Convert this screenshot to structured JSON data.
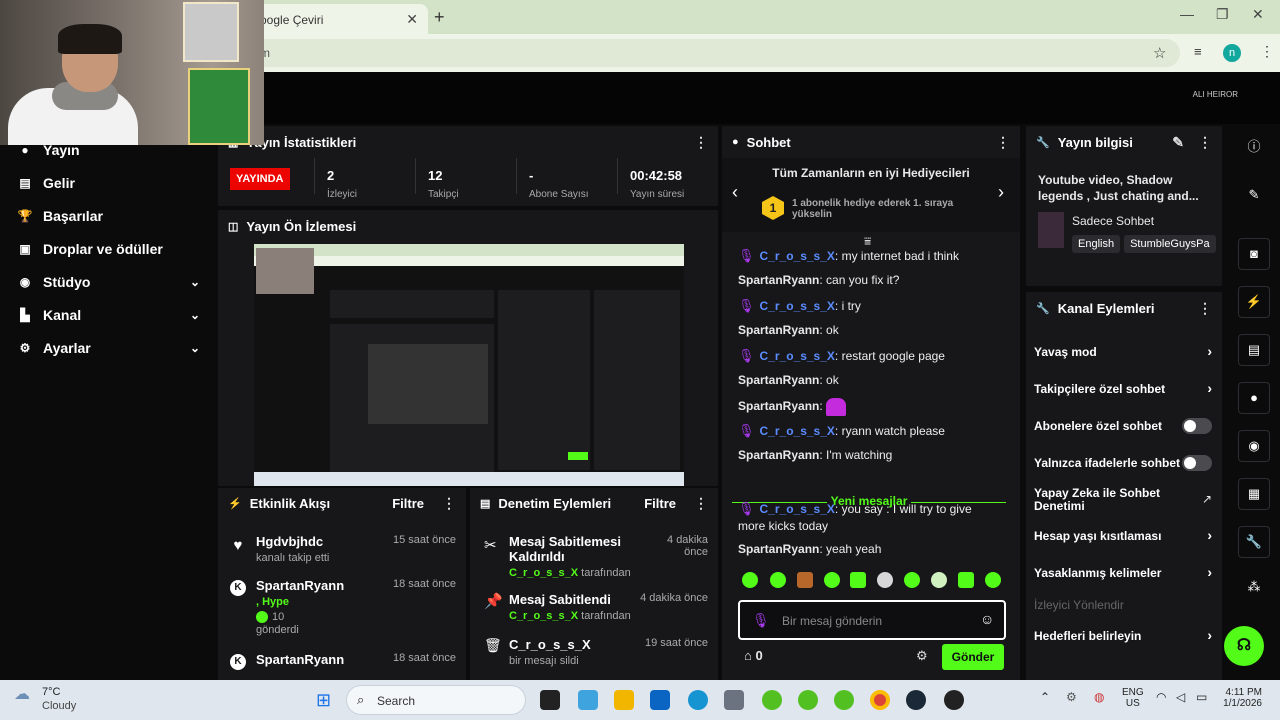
{
  "browser": {
    "tab_title": "oogle Çeviri",
    "tab_close": "✕",
    "new_tab": "+",
    "addr_text": "m",
    "profile_initial": "n"
  },
  "app": {
    "brand_text": "ALI HEIROR"
  },
  "sidebar": {
    "items": [
      {
        "label": "Yayın",
        "icon": "●"
      },
      {
        "label": "Gelir",
        "icon": "▤"
      },
      {
        "label": "Başarılar",
        "icon": "🏆"
      },
      {
        "label": "Droplar ve ödüller",
        "icon": "▣"
      },
      {
        "label": "Stüdyo",
        "icon": "◉"
      },
      {
        "label": "Kanal",
        "icon": "▙"
      },
      {
        "label": "Ayarlar",
        "icon": "⚙"
      }
    ],
    "chevron": "⌄"
  },
  "stats": {
    "title": "Yayın İstatistikleri",
    "live_badge": "YAYINDA",
    "values": [
      "2",
      "12",
      "-",
      "00:42:58"
    ],
    "labels": [
      "İzleyici",
      "Takipçi",
      "Abone Sayısı",
      "Yayın süresi"
    ]
  },
  "preview": {
    "title": "Yayın Ön İzlemesi"
  },
  "activity": {
    "title": "Etkinlik Akışı",
    "filter": "Filtre",
    "items": [
      {
        "name": "Hgdvbjhdc",
        "sub": "kanalı takip etti",
        "time": "15 saat önce"
      },
      {
        "name": "SpartanRyann",
        "sub_hype": ", Hype",
        "sub_count": "10",
        "sub2": "gönderdi",
        "time": "18 saat önce"
      },
      {
        "name": "SpartanRyann",
        "time": "18 saat önce"
      }
    ]
  },
  "moderation": {
    "title": "Denetim Eylemleri",
    "filter": "Filtre",
    "items": [
      {
        "title": "Mesaj Sabitlemesi Kaldırıldı",
        "user": "C_r_o_s_s_X",
        "suffix": "tarafından",
        "time": "4 dakika önce"
      },
      {
        "title": "Mesaj Sabitlendi",
        "user": "C_r_o_s_s_X",
        "suffix": "tarafından",
        "time": "4 dakika önce"
      },
      {
        "title": "C_r_o_s_s_X",
        "sub": "bir mesajı sildi",
        "time": "19 saat önce"
      }
    ]
  },
  "chat": {
    "title": "Sohbet",
    "gifters_title": "Tüm Zamanların en iyi Hediyecileri",
    "gifter_rank": "1",
    "gifter_text": "1 abonelik hediye ederek 1. sıraya yükselin",
    "messages": [
      {
        "nick": "C_r_o_s_s_X",
        "text": "my internet bad i think",
        "mod": true
      },
      {
        "nick": "SpartanRyann",
        "text": "can you fix it?",
        "mod": false
      },
      {
        "nick": "C_r_o_s_s_X",
        "text": "i try",
        "mod": true
      },
      {
        "nick": "SpartanRyann",
        "text": "ok",
        "mod": false
      },
      {
        "nick": "C_r_o_s_s_X",
        "text": "restart google page",
        "mod": true
      },
      {
        "nick": "SpartanRyann",
        "text": "ok",
        "mod": false
      },
      {
        "nick": "SpartanRyann",
        "text": "",
        "mod": false
      },
      {
        "nick": "C_r_o_s_s_X",
        "text": "ryann watch please",
        "mod": true
      },
      {
        "nick": "SpartanRyann",
        "text": "I'm watching",
        "mod": false
      }
    ],
    "new_messages": "Yeni mesajlar",
    "new": [
      {
        "nick": "C_r_o_s_s_X",
        "text": "you say : I will try to give more kicks today",
        "mod": true
      },
      {
        "nick": "SpartanRyann",
        "text": "yeah yeah",
        "mod": false
      }
    ],
    "input_placeholder": "Bir mesaj gönderin",
    "points": "0",
    "send_label": "Gönder"
  },
  "stream_info": {
    "title": "Yayın bilgisi",
    "stream_title": "Youtube video, Shadow legends , Just chating and...",
    "category": "Sadece Sohbet",
    "tags": [
      "English",
      "StumbleGuysPa"
    ]
  },
  "channel_actions": {
    "title": "Kanal Eylemleri",
    "items": [
      {
        "label": "Yavaş mod",
        "type": "chevron"
      },
      {
        "label": "Takipçilere özel sohbet",
        "type": "chevron"
      },
      {
        "label": "Abonelere özel sohbet",
        "type": "toggle"
      },
      {
        "label": "Yalnızca ifadelerle sohbet",
        "type": "toggle"
      },
      {
        "label": "Yapay Zeka ile Sohbet Denetimi",
        "type": "external"
      },
      {
        "label": "Hesap yaşı kısıtlaması",
        "type": "chevron"
      },
      {
        "label": "Yasaklanmış kelimeler",
        "type": "chevron"
      },
      {
        "label": "İzleyici Yönlendir",
        "type": "disabled"
      },
      {
        "label": "Hedefleri belirleyin",
        "type": "chevron"
      }
    ]
  },
  "taskbar": {
    "weather_temp": "7°C",
    "weather_desc": "Cloudy",
    "search_label": "Search",
    "lang": "ENG",
    "region": "US",
    "time": "4:11 PM",
    "date": "1/1/2026"
  },
  "colors": {
    "accent": "#53fc18",
    "live": "#eb0400",
    "panel": "#17171a"
  }
}
